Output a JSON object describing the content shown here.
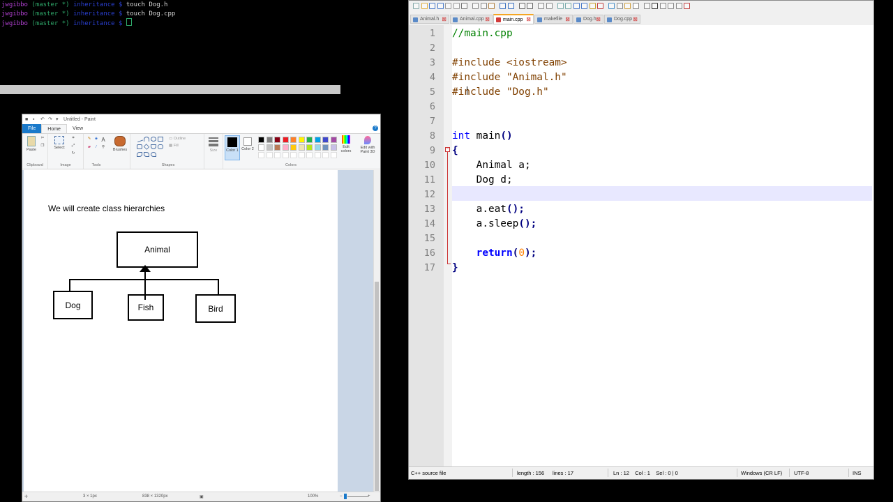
{
  "terminal": {
    "lines": [
      {
        "user": "jwgibbo",
        "branch": "(master *)",
        "dir": "inheritance $",
        "cmd": "touch Dog.h"
      },
      {
        "user": "jwgibbo",
        "branch": "(master *)",
        "dir": "inheritance $",
        "cmd": "touch Dog.cpp"
      },
      {
        "user": "jwgibbo",
        "branch": "(master *)",
        "dir": "inheritance $",
        "cmd": ""
      }
    ]
  },
  "paint": {
    "title": "Untitled - Paint",
    "tabs": {
      "file": "File",
      "home": "Home",
      "view": "View"
    },
    "help": "?",
    "ribbon": {
      "paste": "Paste",
      "select": "Select",
      "brushes": "Brushes",
      "outline": "Outline",
      "fill": "Fill",
      "size": "Size",
      "color1": "Color 1",
      "color2": "Color 2",
      "edit_colors": "Edit colors",
      "edit_paint3d": "Edit with Paint 3D",
      "groups": {
        "clipboard": "Clipboard",
        "image": "Image",
        "tools": "Tools",
        "shapes": "Shapes",
        "colors": "Colors"
      },
      "palette_row1": [
        "#000000",
        "#7f7f7f",
        "#880015",
        "#ed1c24",
        "#ff7f27",
        "#fff200",
        "#22b14c",
        "#00a2e8",
        "#3f48cc",
        "#a349a4"
      ],
      "palette_row2": [
        "#ffffff",
        "#c3c3c3",
        "#b97a57",
        "#ffaec9",
        "#ffc90e",
        "#efe4b0",
        "#b5e61d",
        "#99d9ea",
        "#7092be",
        "#c8bfe7"
      ]
    },
    "canvas": {
      "heading": "We will create class hierarchies",
      "boxes": {
        "animal": "Animal",
        "dog": "Dog",
        "fish": "Fish",
        "bird": "Bird"
      }
    },
    "status": {
      "selection": "3 × 1px",
      "canvas_size": "838 × 1320px",
      "zoom": "100%",
      "zoom_fraction": 0.5
    }
  },
  "npp": {
    "tabs": [
      "Animal.h",
      "Animal.cpp",
      "main.cpp",
      "makefile",
      "Dog.h",
      "Dog.cpp"
    ],
    "active_tab": "main.cpp",
    "line_numbers": [
      "1",
      "2",
      "3",
      "4",
      "5",
      "6",
      "7",
      "8",
      "9",
      "10",
      "11",
      "12",
      "13",
      "14",
      "15",
      "16",
      "17"
    ],
    "code": {
      "l1": "//main.cpp",
      "l3": "#include <iostream>",
      "l4": "#include \"Animal.h\"",
      "l5": "#include \"Dog.h\"",
      "l8_kw": "int",
      "l8_rest": " main",
      "l8_paren": "()",
      "l9": "{",
      "l10": "    Animal a;",
      "l11": "    Dog d;",
      "l13_a": "    a.eat",
      "l13_b": "();",
      "l14_a": "    a.sleep",
      "l14_b": "();",
      "l16_indent": "    ",
      "l16_kw": "return",
      "l16_open": "(",
      "l16_num": "0",
      "l16_close": ");",
      "l17": "}"
    },
    "status": {
      "filetype": "C++ source file",
      "length": "length : 156",
      "lines": "lines : 17",
      "position": "Ln : 12    Col : 1    Sel : 0 | 0",
      "eol": "Windows (CR LF)",
      "encoding": "UTF-8",
      "mode": "INS"
    }
  }
}
